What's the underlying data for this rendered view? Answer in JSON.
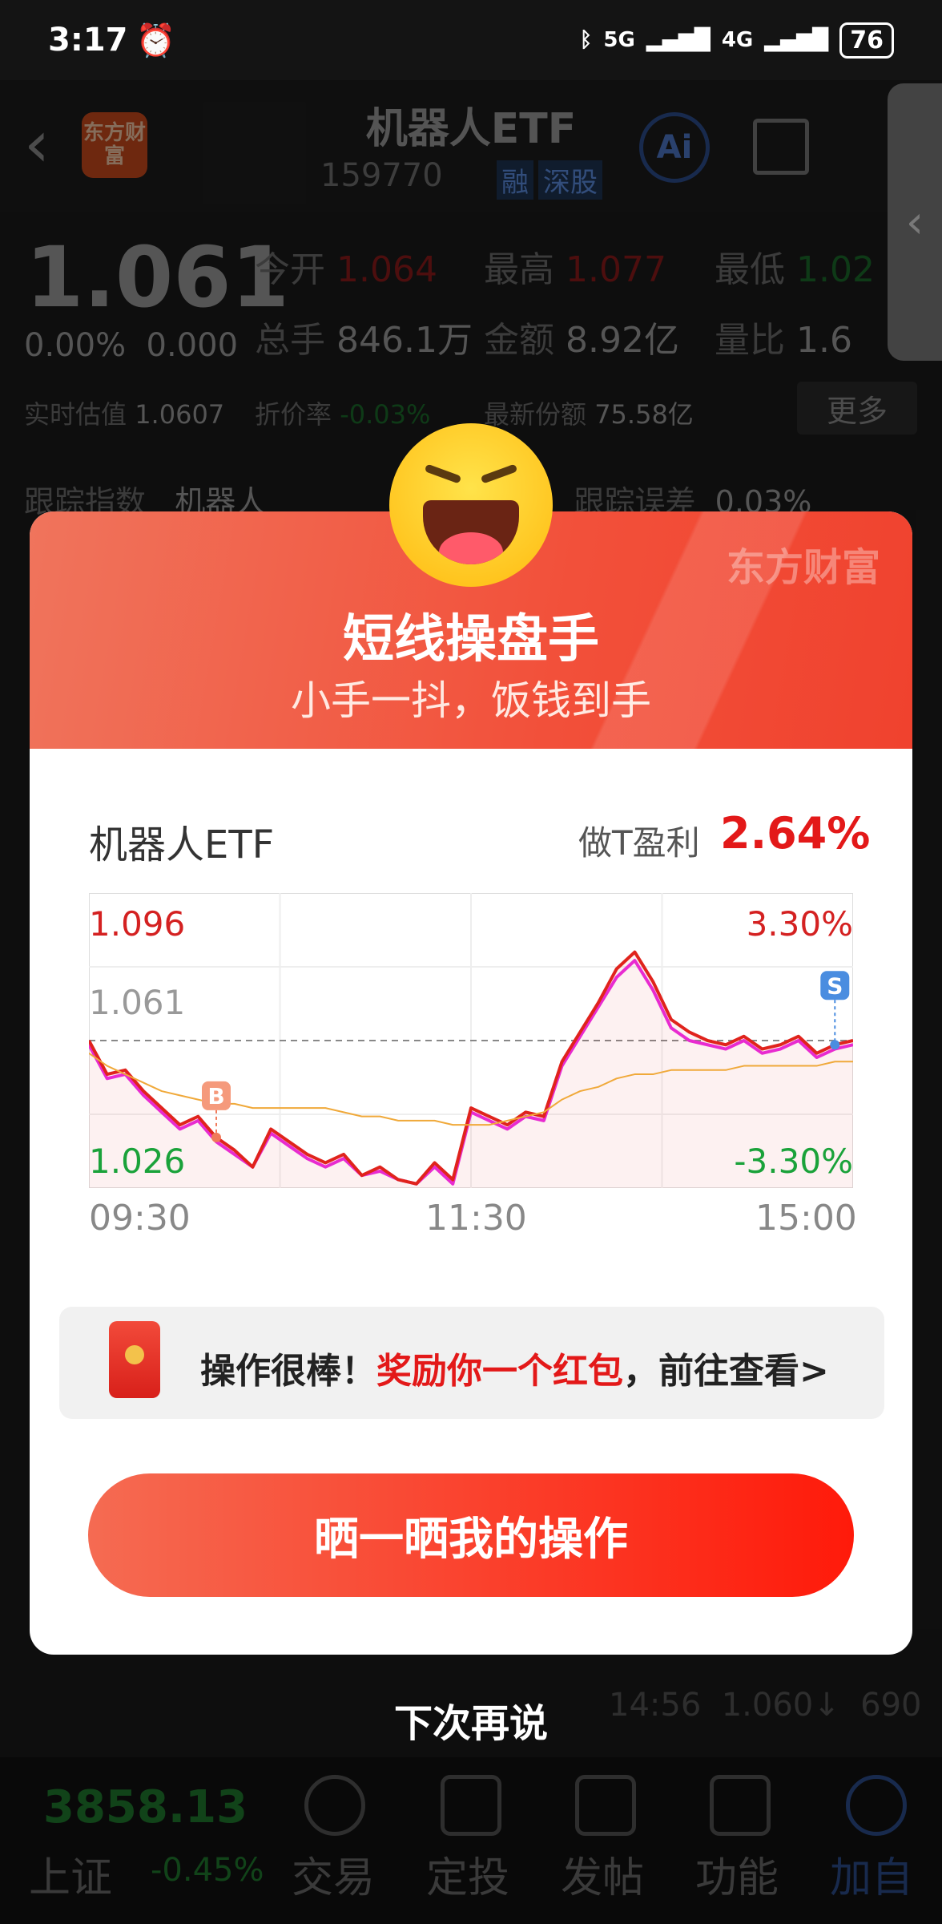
{
  "status": {
    "time": "3:17",
    "battery": "76",
    "net1": "5G",
    "net2": "4G"
  },
  "header": {
    "title": "机器人ETF",
    "code": "159770",
    "tag1": "融",
    "tag2": "深股",
    "logo": "东方财富",
    "ai": "Ai"
  },
  "quote": {
    "price": "1.061",
    "change_pct": "0.00%",
    "change": "0.000",
    "open_lbl": "今开",
    "open": "1.064",
    "high_lbl": "最高",
    "high": "1.077",
    "low_lbl": "最低",
    "low": "1.02",
    "vol_lbl": "总手",
    "vol": "846.1万",
    "amt_lbl": "金额",
    "amt": "8.92亿",
    "ratio_lbl": "量比",
    "ratio": "1.6",
    "est_lbl": "实时估值",
    "est": "1.0607",
    "disc_lbl": "折价率",
    "disc": "-0.03%",
    "share_lbl": "最新份额",
    "share": "75.58亿",
    "more": "更多",
    "track_lbl": "跟踪指数",
    "track_idx": "机器人",
    "err_lbl": "跟踪误差",
    "err": "0.03%"
  },
  "modal": {
    "brand": "东方财富",
    "title": "短线操盘手",
    "subtitle": "小手一抖，饭钱到手",
    "name": "机器人ETF",
    "profit_lbl": "做T盈利",
    "profit": "2.64%",
    "reward_prefix": "操作很棒！",
    "reward_highlight": "奖励你一个红包",
    "reward_suffix": "，前往查看>",
    "share_button": "晒一晒我的操作",
    "later": "下次再说"
  },
  "chart_data": {
    "type": "line",
    "title": "",
    "x_ticks": [
      "09:30",
      "11:30",
      "15:00"
    ],
    "y_left": {
      "max": "1.096",
      "mid": "1.061",
      "min": "1.026"
    },
    "y_right": {
      "max": "3.30%",
      "min": "-3.30%"
    },
    "ylim": [
      1.026,
      1.096
    ],
    "prev_close": 1.061,
    "series": [
      {
        "values": [
          1.061,
          1.053,
          1.054,
          1.049,
          1.045,
          1.041,
          1.043,
          1.038,
          1.035,
          1.031,
          1.04,
          1.037,
          1.034,
          1.032,
          1.034,
          1.029,
          1.031,
          1.028,
          1.027,
          1.032,
          1.028,
          1.045,
          1.043,
          1.041,
          1.044,
          1.043,
          1.056,
          1.063,
          1.07,
          1.078,
          1.082,
          1.075,
          1.066,
          1.063,
          1.061,
          1.06,
          1.062,
          1.059,
          1.06,
          1.062,
          1.058,
          1.06,
          1.061
        ]
      },
      {
        "values": [
          1.06,
          1.052,
          1.053,
          1.048,
          1.044,
          1.04,
          1.042,
          1.037,
          1.034,
          1.031,
          1.039,
          1.036,
          1.033,
          1.031,
          1.033,
          1.029,
          1.03,
          1.028,
          1.027,
          1.031,
          1.027,
          1.044,
          1.042,
          1.04,
          1.043,
          1.042,
          1.055,
          1.062,
          1.069,
          1.076,
          1.08,
          1.073,
          1.064,
          1.061,
          1.06,
          1.059,
          1.061,
          1.058,
          1.059,
          1.061,
          1.057,
          1.059,
          1.06
        ]
      },
      {
        "values": [
          1.058,
          1.055,
          1.053,
          1.051,
          1.049,
          1.048,
          1.047,
          1.046,
          1.046,
          1.045,
          1.045,
          1.045,
          1.045,
          1.045,
          1.044,
          1.043,
          1.043,
          1.042,
          1.042,
          1.042,
          1.041,
          1.041,
          1.041,
          1.042,
          1.043,
          1.044,
          1.047,
          1.049,
          1.05,
          1.052,
          1.053,
          1.053,
          1.054,
          1.054,
          1.054,
          1.054,
          1.055,
          1.055,
          1.055,
          1.055,
          1.055,
          1.056,
          1.056
        ]
      }
    ],
    "markers": [
      {
        "label": "B",
        "index": 7
      },
      {
        "label": "S",
        "index": 41
      }
    ],
    "colors": {
      "price": "#e0231c",
      "avg_b": "#e82bd0",
      "avg": "#f0a93a",
      "up": "#e31919",
      "down": "#1aa23a"
    }
  },
  "nav": {
    "index_val": "3858.13",
    "index_name": "上证",
    "index_chg": "-0.45%",
    "trade": "交易",
    "plan": "定投",
    "post": "发帖",
    "func": "功能",
    "add": "加自"
  }
}
